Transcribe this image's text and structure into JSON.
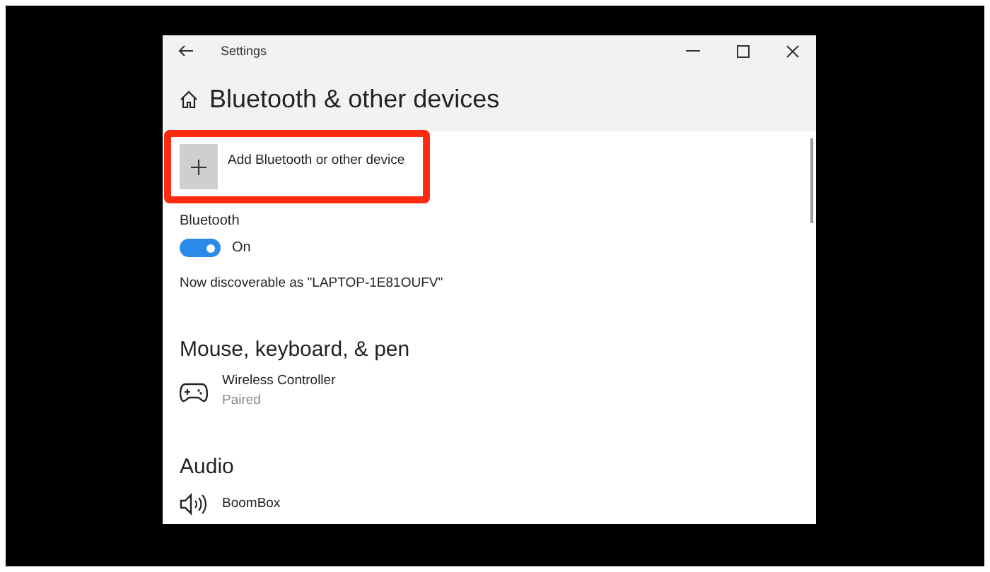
{
  "window": {
    "title": "Settings"
  },
  "page": {
    "title": "Bluetooth & other devices"
  },
  "add_device_button": {
    "label": "Add Bluetooth or other device"
  },
  "bluetooth": {
    "label": "Bluetooth",
    "on": true,
    "state_text": "On",
    "discoverable_text": "Now discoverable as \"LAPTOP-1E81OUFV\""
  },
  "sections": [
    {
      "title": "Mouse, keyboard, & pen",
      "devices": [
        {
          "kind": "controller",
          "name": "Wireless Controller",
          "status": "Paired"
        }
      ]
    },
    {
      "title": "Audio",
      "devices": [
        {
          "kind": "speaker",
          "name": "BoomBox"
        }
      ]
    }
  ]
}
